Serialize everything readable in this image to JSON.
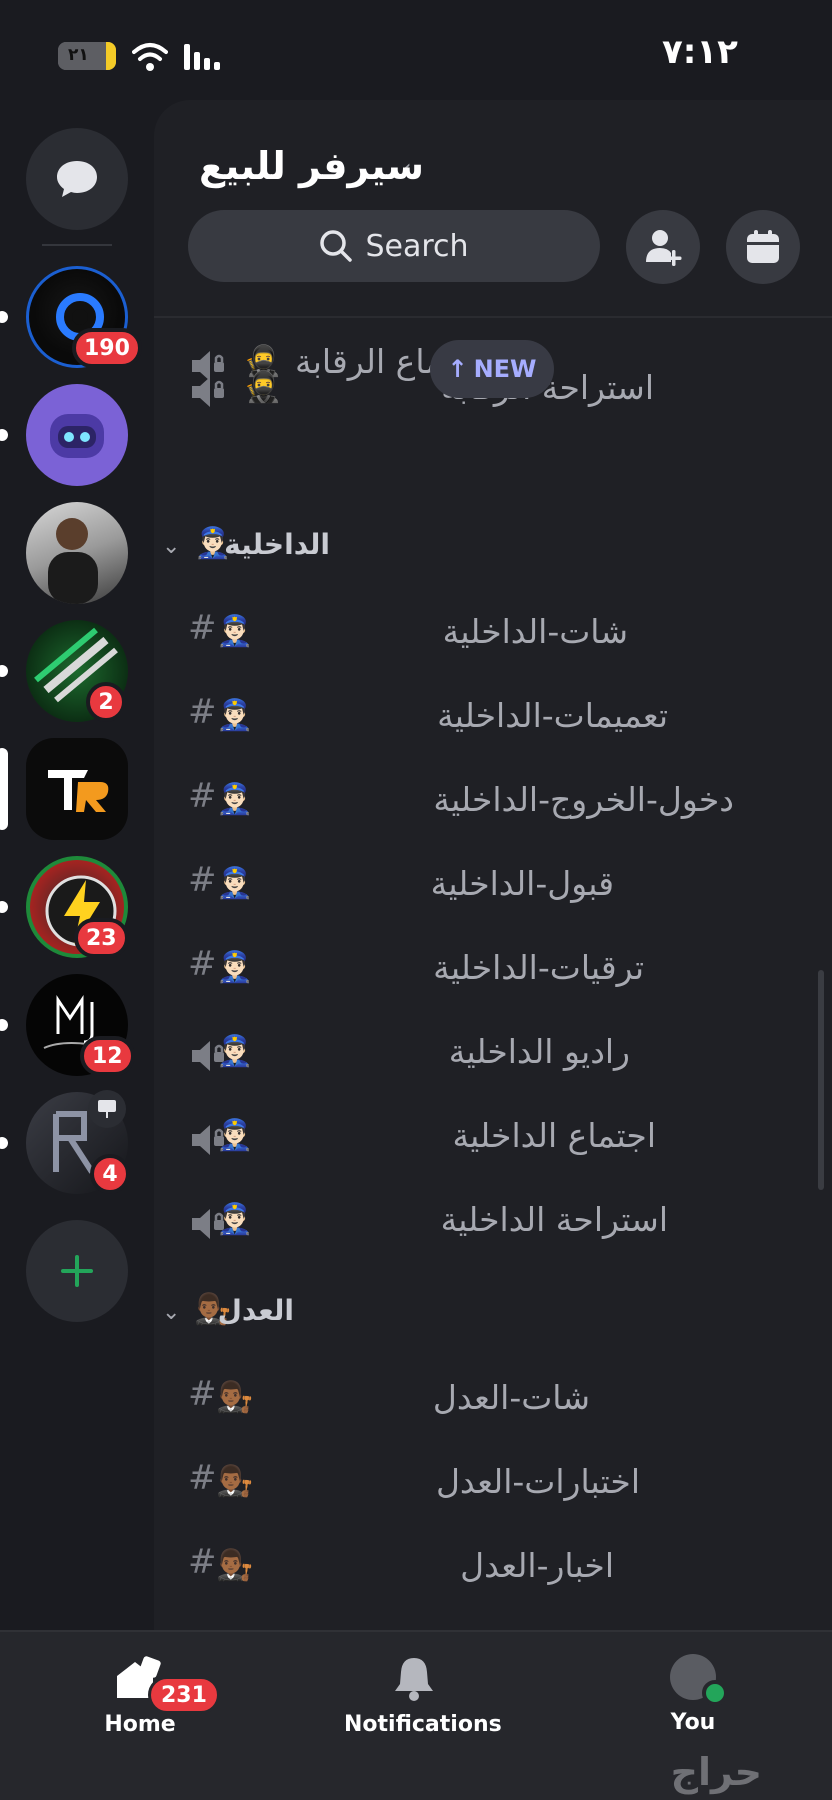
{
  "status_bar": {
    "time": "٧:١٢",
    "battery": "٢١"
  },
  "server_rail": {
    "badges": [
      "190",
      "2",
      "23",
      "12",
      "4"
    ]
  },
  "header": {
    "server_name": "سيرفر للبيع",
    "search_label": "Search"
  },
  "new_pill": {
    "label": "NEW"
  },
  "channels": {
    "top_voice_1": "اجتماع الرقابة",
    "top_voice_2": "استراحة الرقابة",
    "category_interior": "الداخلية",
    "interior_chat": "شات-الداخلية",
    "interior_announcements": "تعميمات-الداخلية",
    "interior_entry_exit": "دخول-الخروج-الداخلية",
    "interior_acceptance": "قبول-الداخلية",
    "interior_promotions": "ترقيات-الداخلية",
    "interior_radio": "راديو الداخلية",
    "interior_meeting": "اجتماع الداخلية",
    "interior_break": "استراحة الداخلية",
    "category_justice": "العدل",
    "justice_chat": "شات-العدل",
    "justice_tests": "اختبارات-العدل",
    "justice_news": "اخبار-العدل"
  },
  "emojis": {
    "ninja": "🥷",
    "police": "👮🏻‍♂️",
    "judge": "👨🏾‍⚖️"
  },
  "bottom_nav": {
    "home_label": "Home",
    "home_badge": "231",
    "notifications_label": "Notifications",
    "you_label": "You"
  },
  "watermark": "حراج",
  "colors": {
    "accent_badge": "#e8393f",
    "online": "#23a55a",
    "new_pill_text": "#a6adff",
    "add_server": "#23a55a"
  }
}
